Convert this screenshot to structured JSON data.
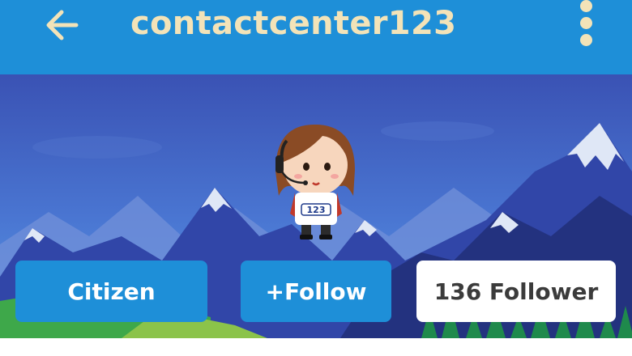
{
  "header": {
    "title": "contactcenter123",
    "back_icon": "arrow-left-icon",
    "menu_icon": "more-vertical-icon",
    "bar_color": "#1e8fd8",
    "icon_color": "#f3e3b8"
  },
  "avatar": {
    "badge_text": "123"
  },
  "actions": {
    "citizen_label": "Citizen",
    "follow_label": "+Follow",
    "followers_label": "136 Follower"
  }
}
